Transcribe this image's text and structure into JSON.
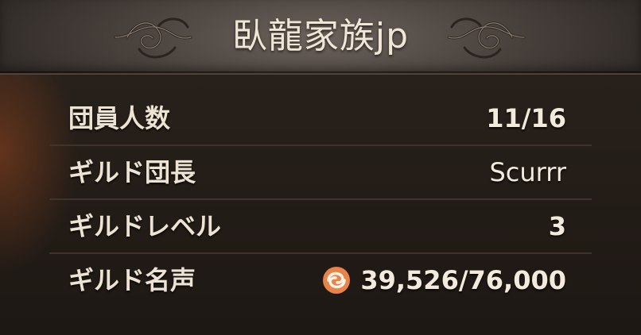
{
  "guild": {
    "name": "臥龍家族jp"
  },
  "stats": {
    "members_label": "団員人数",
    "members_value": "11/16",
    "leader_label": "ギルド団長",
    "leader_value": "Scurrr",
    "level_label": "ギルドレベル",
    "level_value": "3",
    "fame_label": "ギルド名声",
    "fame_value": "39,526/76,000",
    "fame_icon": "fame-swirl-icon"
  },
  "colors": {
    "text": "#ece3d3",
    "accent_icon": "#e8834a"
  }
}
